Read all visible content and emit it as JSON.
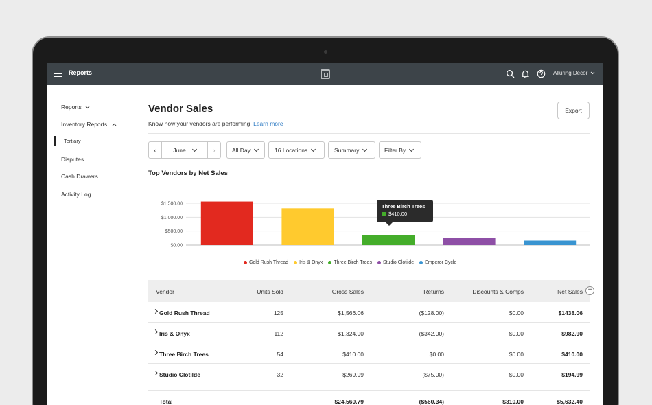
{
  "topbar": {
    "title": "Reports",
    "account": "Alluring Decor",
    "icons": [
      "menu-icon",
      "square-logo-icon",
      "search-icon",
      "bell-icon",
      "help-icon",
      "chevron-down-icon"
    ]
  },
  "sidebar": {
    "items": [
      {
        "label": "Reports"
      },
      {
        "label": "Inventory Reports"
      },
      {
        "label": "Tertiary"
      },
      {
        "label": "Disputes"
      },
      {
        "label": "Cash Drawers"
      },
      {
        "label": "Activity Log"
      }
    ]
  },
  "page": {
    "title": "Vendor Sales",
    "subtitle": "Know how your vendors are performing.",
    "learn_more": "Learn more",
    "export_label": "Export"
  },
  "filters": {
    "prev": "‹",
    "month": "June",
    "next": "›",
    "time": "All Day",
    "locations": "16 Locations",
    "view": "Summary",
    "filter_by": "Filter By"
  },
  "chart_title": "Top Vendors by Net Sales",
  "chart_data": {
    "type": "bar",
    "title": "Top Vendors by Net Sales",
    "categories": [
      "Gold Rush Thread",
      "Iris & Onyx",
      "Three Birch Trees",
      "Studio Clotilde",
      "Emperor Cycle"
    ],
    "values": [
      1560,
      1320,
      350,
      250,
      160
    ],
    "colors": [
      "#e2291f",
      "#ffca2e",
      "#44ad2a",
      "#8e4fa6",
      "#3994d1"
    ],
    "ylim": [
      0,
      1500
    ],
    "yticks": [
      "$0.00",
      "$500.00",
      "$1,000.00",
      "$1,500.00"
    ],
    "ytick_values": [
      0,
      500,
      1000,
      1500
    ],
    "legend_position": "bottom",
    "grid": true,
    "tooltip": {
      "title": "Three Birch Trees",
      "value": "$410.00",
      "color": "#44ad2a"
    }
  },
  "table": {
    "headers": [
      "Vendor",
      "Units Sold",
      "Gross Sales",
      "Returns",
      "Discounts & Comps",
      "Net Sales"
    ],
    "rows": [
      {
        "vendor": "Gold Rush Thread",
        "units": "125",
        "gross": "$1,566.06",
        "returns": "($128.00)",
        "discounts": "$0.00",
        "net": "$1438.06"
      },
      {
        "vendor": "Iris & Onyx",
        "units": "112",
        "gross": "$1,324.90",
        "returns": "($342.00)",
        "discounts": "$0.00",
        "net": "$982.90"
      },
      {
        "vendor": "Three Birch Trees",
        "units": "54",
        "gross": "$410.00",
        "returns": "$0.00",
        "discounts": "$0.00",
        "net": "$410.00"
      },
      {
        "vendor": "Studio Clotilde",
        "units": "32",
        "gross": "$269.99",
        "returns": "($75.00)",
        "discounts": "$0.00",
        "net": "$194.99"
      }
    ],
    "total": {
      "label": "Total",
      "gross": "$24,560.79",
      "returns": "($560.34)",
      "discounts": "$310.00",
      "net": "$5,632.40"
    },
    "add_column": "+"
  }
}
